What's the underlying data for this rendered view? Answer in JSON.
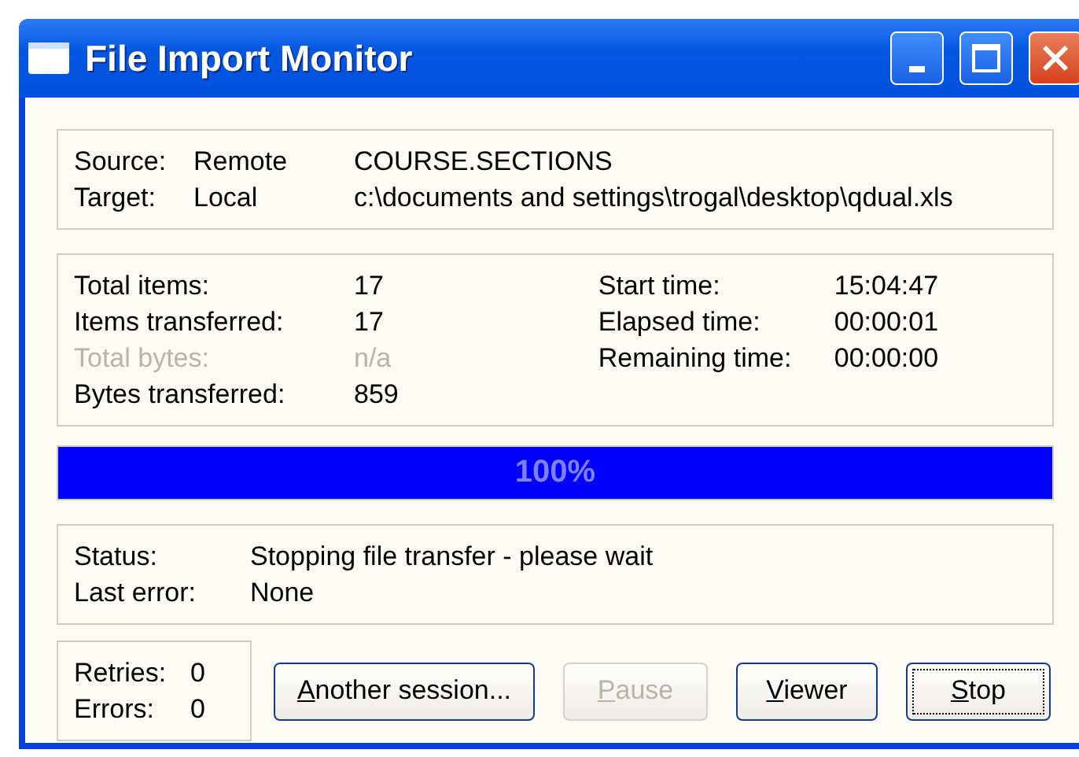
{
  "window": {
    "title": "File Import Monitor"
  },
  "transfer": [
    {
      "label": "Source:",
      "location": "Remote",
      "path": "COURSE.SECTIONS"
    },
    {
      "label": "Target:",
      "location": "Local",
      "path": "c:\\documents and settings\\trogal\\desktop\\qdual.xls"
    }
  ],
  "counts": {
    "left": [
      {
        "label": "Total items:",
        "value": "17",
        "disabled": false
      },
      {
        "label": "Items transferred:",
        "value": "17",
        "disabled": false
      },
      {
        "label": "Total bytes:",
        "value": "n/a",
        "disabled": true
      },
      {
        "label": "Bytes transferred:",
        "value": "859",
        "disabled": false
      }
    ],
    "right": [
      {
        "label": "Start time:",
        "value": "15:04:47",
        "disabled": false
      },
      {
        "label": "Elapsed time:",
        "value": "00:00:01",
        "disabled": false
      },
      {
        "label": "Remaining time:",
        "value": "00:00:00",
        "disabled": false
      }
    ]
  },
  "progress": {
    "level": 1,
    "reading": "100%"
  },
  "status": [
    {
      "label": "Status:",
      "value": "Stopping file transfer - please wait"
    },
    {
      "label": "Last error:",
      "value": "None"
    }
  ],
  "tallies": [
    {
      "label": "Retries:",
      "value": "0"
    },
    {
      "label": "Errors:",
      "value": "0"
    }
  ],
  "buttons": [
    {
      "label": "Another session...",
      "underline_first": true,
      "disabled": false,
      "focused": false
    },
    {
      "label": "Pause",
      "underline_first": true,
      "disabled": true,
      "focused": false
    },
    {
      "label": "Viewer",
      "underline_first": true,
      "disabled": false,
      "focused": false
    },
    {
      "label": "Stop",
      "underline_first": true,
      "disabled": false,
      "focused": true
    }
  ]
}
